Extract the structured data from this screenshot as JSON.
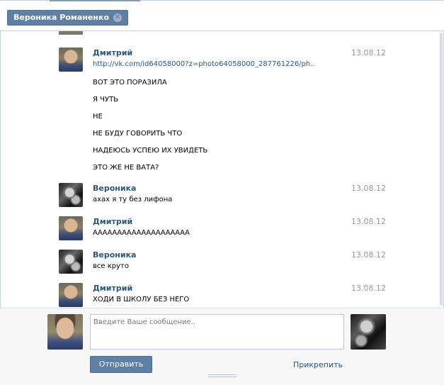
{
  "tab": {
    "title": "Вероника Романенко",
    "close_icon": "close-icon"
  },
  "messages": [
    {
      "author": "Дмитрий",
      "author_type": "dmitriy",
      "date": "13.08.12",
      "lines": [
        "http://vk.com/id64058000?z=photo64058000_287761226/ph..",
        "ВОТ ЭТО ПОРАЗИЛА",
        "Я ЧУТЬ",
        "НЕ",
        "НЕ БУДУ ГОВОРИТЬ ЧТО",
        "НАДЕЮСЬ УСПЕЮ ИХ УВИДЕТЬ",
        "ЭТО ЖЕ НЕ ВАТА?"
      ]
    },
    {
      "author": "Вероника",
      "author_type": "veronika",
      "date": "13.08.12",
      "lines": [
        "ахах я ту без лифона"
      ]
    },
    {
      "author": "Дмитрий",
      "author_type": "dmitriy",
      "date": "13.08.12",
      "lines": [
        "АААААААААААААААААААА"
      ]
    },
    {
      "author": "Вероника",
      "author_type": "veronika",
      "date": "13.08.12",
      "lines": [
        "все круто"
      ]
    },
    {
      "author": "Дмитрий",
      "author_type": "dmitriy",
      "date": "13.08.12",
      "lines": [
        "ХОДИ В ШКОЛУ БЕЗ НЕГО"
      ]
    }
  ],
  "composer": {
    "placeholder": "Введите Ваше сообщение..",
    "value": "",
    "send_label": "Отправить",
    "attach_label": "Прикрепить"
  },
  "colors": {
    "accent": "#5e80a5",
    "link": "#2b587a",
    "date": "#999999"
  }
}
